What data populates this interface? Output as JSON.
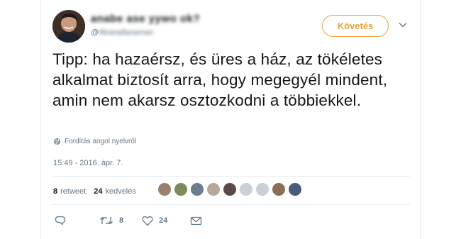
{
  "user": {
    "display_name": "anabe ase yywo ok?",
    "screen_name_prefix": "@",
    "screen_name": "lifeanallanaman"
  },
  "follow_label": "Követés",
  "tweet_text": "Tipp: ha hazaérsz, és üres a ház, az tökéletes alkalmat biztosít arra, hogy megegyél mindent, amin nem akarsz osztozkodni a többiekkel.",
  "translate_label": "Fordítás angol nyelvről",
  "timestamp": "15:49 - 2016. ápr. 7.",
  "stats": {
    "retweets_count": "8",
    "retweets_label": "retweet",
    "likes_count": "24",
    "likes_label": "kedvelés"
  },
  "liker_avatars": [
    "#9a7f6b",
    "#7b8c5a",
    "#6b7c8f",
    "#b8a89a",
    "#5a4a4a",
    "#c9d1d8",
    "#c9d1d8",
    "#8a6f55",
    "#4a5a7a"
  ],
  "actions": {
    "reply_count": "",
    "retweet_count": "8",
    "like_count": "24"
  },
  "colors": {
    "accent": "#e8a13c",
    "secondary_text": "#657786",
    "divider": "#e6ecf0"
  }
}
